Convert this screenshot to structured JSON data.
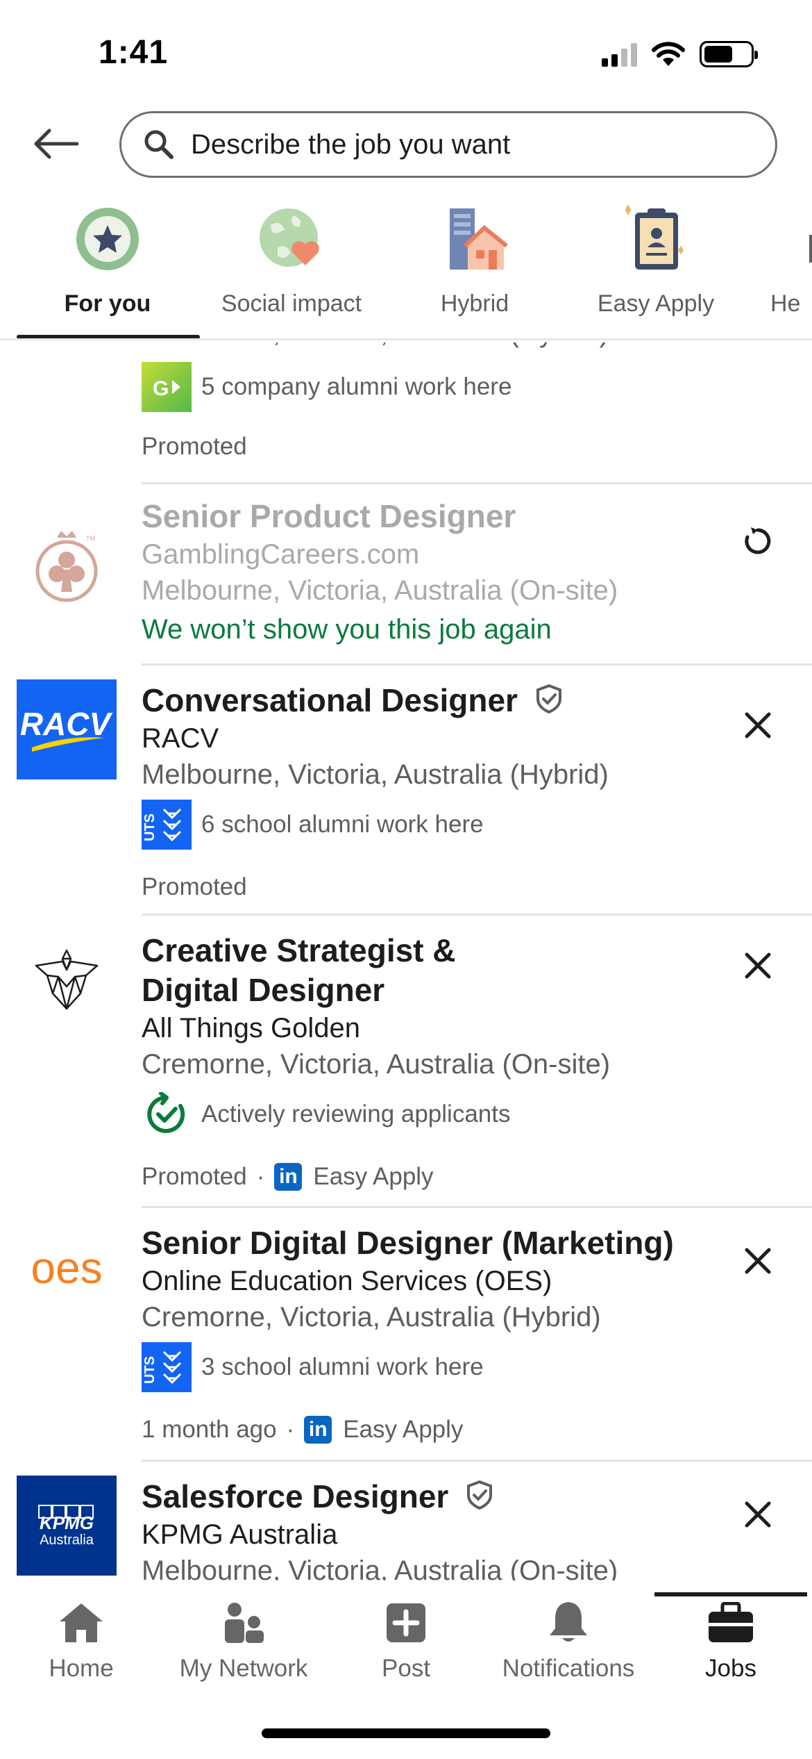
{
  "status_bar": {
    "time": "1:41"
  },
  "search": {
    "placeholder": "Describe the job you want"
  },
  "tabs": [
    {
      "label": "For you",
      "active": true
    },
    {
      "label": "Social impact"
    },
    {
      "label": "Hybrid"
    },
    {
      "label": "Easy Apply"
    },
    {
      "label": "He"
    }
  ],
  "jobs": [
    {
      "location": "Melbourne, Victoria, Australia (Hybrid)",
      "insight": "5 company alumni work here",
      "footer": "Promoted"
    },
    {
      "title": "Senior Product Designer",
      "company": "GamblingCareers.com",
      "location": "Melbourne, Victoria, Australia (On-site)",
      "hidden_note": "We won’t show you this job again"
    },
    {
      "title": "Conversational Designer",
      "company": "RACV",
      "logo_text": "RACV",
      "location": "Melbourne, Victoria, Australia (Hybrid)",
      "insight": "6 school alumni work here",
      "footer": "Promoted"
    },
    {
      "title_line1": "Creative Strategist &",
      "title_line2": "Digital Designer",
      "company": "All Things Golden",
      "location": "Cremorne, Victoria, Australia (On-site)",
      "insight": "Actively reviewing applicants",
      "footer": "Promoted",
      "easy_apply": "Easy Apply"
    },
    {
      "title": "Senior Digital Designer (Marketing)",
      "company": "Online Education Services (OES)",
      "logo_text": "oes",
      "location": "Cremorne, Victoria, Australia (Hybrid)",
      "insight": "3 school alumni work here",
      "footer": "1 month ago",
      "easy_apply": "Easy Apply"
    },
    {
      "title": "Salesforce Designer",
      "company": "KPMG Australia",
      "logo_text": "KPMG",
      "logo_subtext": "Australia",
      "location": "Melbourne, Victoria, Australia (On-site)"
    }
  ],
  "bottom_nav": [
    {
      "label": "Home"
    },
    {
      "label": "My Network"
    },
    {
      "label": "Post"
    },
    {
      "label": "Notifications"
    },
    {
      "label": "Jobs",
      "active": true
    }
  ],
  "colors": {
    "linkedin_blue": "#0a66c2",
    "racv_blue": "#1464f4",
    "kpmg_blue": "#00338d",
    "oes_orange": "#f5821f",
    "success_green": "#0b7a3e"
  }
}
